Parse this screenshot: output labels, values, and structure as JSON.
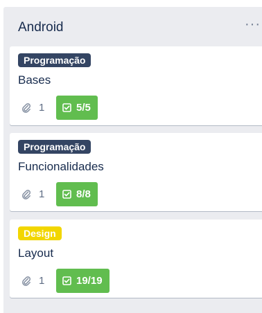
{
  "list": {
    "title": "Android",
    "menu_icon": "ellipsis-icon",
    "menu_glyph": "···"
  },
  "cards": [
    {
      "label": "Programação",
      "label_color": "#344563",
      "title": "Bases",
      "attachments": "1",
      "checklist": "5/5",
      "checklist_color": "#61bd4f"
    },
    {
      "label": "Programação",
      "label_color": "#344563",
      "title": "Funcionalidades",
      "attachments": "1",
      "checklist": "8/8",
      "checklist_color": "#61bd4f"
    },
    {
      "label": "Design",
      "label_color": "#f2d600",
      "title": "Layout",
      "attachments": "1",
      "checklist": "19/19",
      "checklist_color": "#61bd4f"
    }
  ]
}
